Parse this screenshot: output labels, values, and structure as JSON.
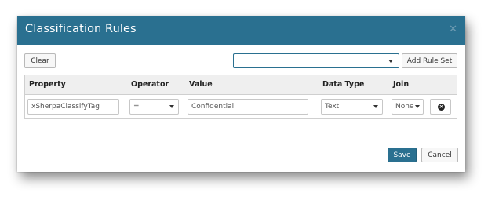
{
  "dialog": {
    "title": "Classification Rules",
    "close_icon": "close-icon",
    "header_color": "#2a7090"
  },
  "toolbar": {
    "clear_label": "Clear",
    "ruleset_value": "",
    "add_rule_set_label": "Add Rule Set"
  },
  "table": {
    "columns": [
      "Property",
      "Operator",
      "Value",
      "Data Type",
      "Join"
    ],
    "rows": [
      {
        "property": "xSherpaClassifyTag",
        "operator": "=",
        "value": "Confidential",
        "data_type": "Text",
        "join": "None",
        "remove_icon": "remove-circle-icon"
      }
    ]
  },
  "footer": {
    "save_label": "Save",
    "cancel_label": "Cancel"
  }
}
